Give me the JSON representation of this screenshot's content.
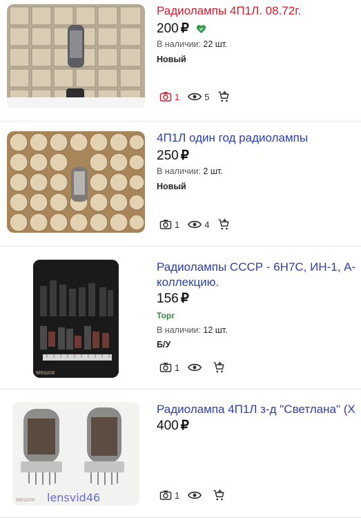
{
  "listings": [
    {
      "title": "Радиолампы 4П1Л. 08.72г.",
      "title_color": "#cf1f2b",
      "price": "200",
      "currency": "₽",
      "price_badge_icon": "heart-icon",
      "stock_label": "В наличии:",
      "stock_value": "22 шт.",
      "condition": "Новый",
      "photos": "1",
      "views": "5",
      "photo_highlight": true
    },
    {
      "title": "4П1Л один год радиолампы",
      "price": "250",
      "currency": "₽",
      "stock_label": "В наличии:",
      "stock_value": "2 шт.",
      "condition": "Новый",
      "photos": "1",
      "views": "4"
    },
    {
      "title": "Радиолампы СССР - 6Н7С, ИН-1, А-коллекцию.",
      "title_line1": "Радиолампы СССР - 6Н7С, ИН-1, А-",
      "title_line2": "коллекцию.",
      "price": "156",
      "currency": "₽",
      "bargain": "Торг",
      "stock_label": "В наличии:",
      "stock_value": "12 шт.",
      "condition": "Б/У",
      "photos": "1",
      "views": "",
      "thumb_watermark": "мешок"
    },
    {
      "title": "Радиолампа 4П1Л з-д \"Светлана\" (X",
      "price": "400",
      "currency": "₽",
      "photos": "1",
      "views": "",
      "thumb_watermark": "мешок",
      "thumb_caption": "lensvid46"
    }
  ],
  "icons": {
    "camera": "camera-icon",
    "eye": "eye-icon",
    "cart": "add-to-cart-icon"
  },
  "colors": {
    "title_link": "#2c3ea8",
    "title_highlight": "#cf1f2b",
    "bargain": "#2e8a3a",
    "heart": "#2e9a4c"
  }
}
